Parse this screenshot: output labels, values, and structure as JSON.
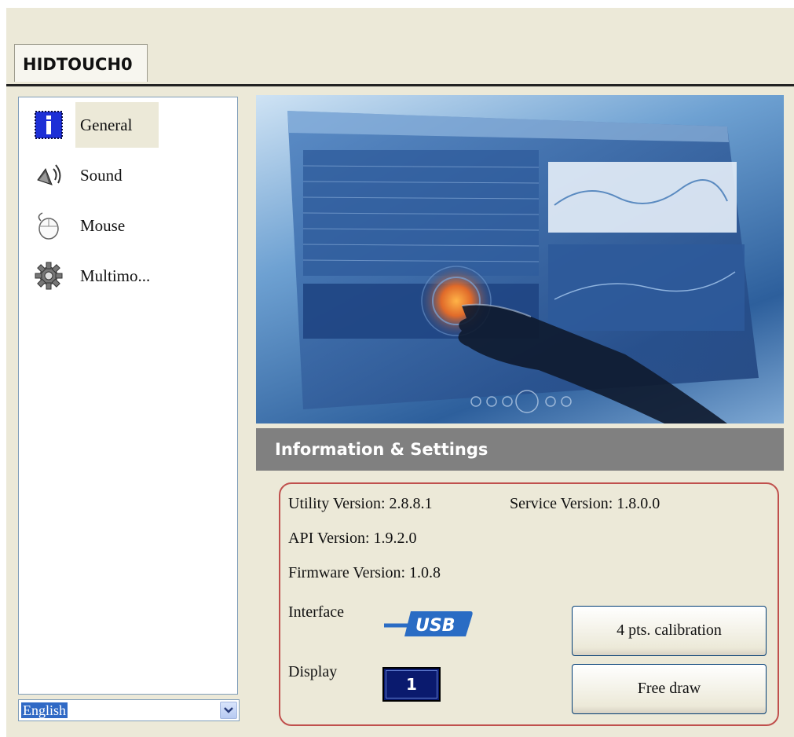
{
  "device_tab": {
    "label": "HIDTOUCH0"
  },
  "sidebar": {
    "items": [
      {
        "label": "General",
        "icon": "info-icon"
      },
      {
        "label": "Sound",
        "icon": "speaker-icon"
      },
      {
        "label": "Mouse",
        "icon": "mouse-icon"
      },
      {
        "label": "Multimo...",
        "icon": "gear-icon"
      }
    ]
  },
  "language": {
    "selected": "English"
  },
  "info": {
    "header": "Information & Settings",
    "utility_version": "Utility Version: 2.8.8.1",
    "service_version": "Service Version: 1.8.0.0",
    "api_version": "API Version: 1.9.2.0",
    "firmware_version": "Firmware Version: 1.0.8",
    "interface_label": "Interface",
    "interface_logo": "USB",
    "display_label": "Display",
    "display_value": "1"
  },
  "buttons": {
    "calibration": "4 pts. calibration",
    "free_draw": "Free draw"
  },
  "colors": {
    "window_bg": "#ece9d8",
    "header_bg": "#808080",
    "box_border": "#c0504d",
    "display_bg": "#0a1a6e",
    "selection": "#316ac5"
  }
}
